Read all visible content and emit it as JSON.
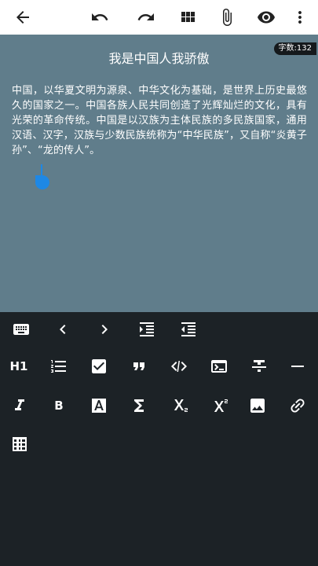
{
  "app_bar": {
    "back_icon": "arrow-left-icon",
    "undo_icon": "undo-icon",
    "redo_icon": "redo-icon",
    "grid_icon": "apps-grid-icon",
    "attach_icon": "paperclip-icon",
    "preview_icon": "eye-icon",
    "more_icon": "more-vertical-icon"
  },
  "editor": {
    "char_count": "字数:132",
    "title": "我是中国人我骄傲",
    "body": "中国，以华夏文明为源泉、中华文化为基础，是世界上历史最悠久的国家之一。中国各族人民共同创造了光辉灿烂的文化，具有光荣的革命传统。中国是以汉族为主体民族的多民族国家，通用汉语、汉字，汉族与少数民族统称为“中华民族”，又自称“炎黄子孙”、“龙的传人”。",
    "background": "#607d8b",
    "cursor_color": "#1e88e5"
  },
  "toolbar": {
    "heading_label": "H1",
    "bold_label": "B",
    "row1": [
      "keyboard-icon",
      "chevron-left-icon",
      "chevron-right-icon",
      "indent-increase-icon",
      "indent-decrease-icon"
    ],
    "row2": [
      "heading-1-icon",
      "numbered-list-icon",
      "checkbox-icon",
      "quote-icon",
      "code-icon",
      "terminal-icon",
      "strikethrough-icon",
      "horizontal-rule-icon"
    ],
    "row3": [
      "italic-icon",
      "bold-icon",
      "text-color-icon",
      "sigma-icon",
      "subscript-icon",
      "superscript-icon",
      "image-icon",
      "link-icon"
    ],
    "row4": [
      "table-icon"
    ],
    "background": "#1c2226"
  }
}
